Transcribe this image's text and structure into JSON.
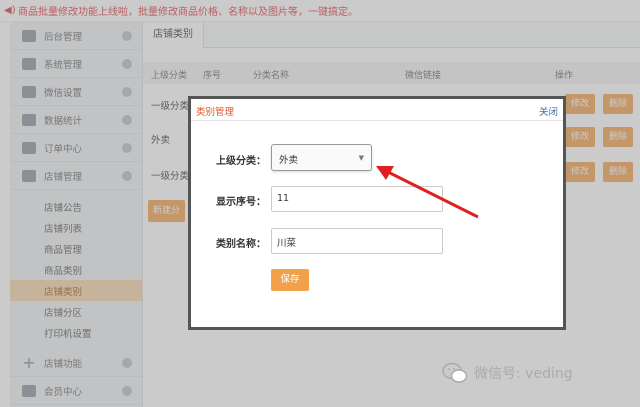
{
  "announcement": "商品批量修改功能上线啦，批量修改商品价格、名称以及图片等，一键搞定。",
  "sidebar": {
    "items": [
      {
        "label": "后台管理"
      },
      {
        "label": "系统管理"
      },
      {
        "label": "微信设置"
      },
      {
        "label": "数据统计"
      },
      {
        "label": "订单中心"
      },
      {
        "label": "店铺管理"
      }
    ],
    "subitems": [
      {
        "label": "店铺公告"
      },
      {
        "label": "店铺列表"
      },
      {
        "label": "商品管理"
      },
      {
        "label": "商品类别"
      },
      {
        "label": "店铺类别"
      },
      {
        "label": "店铺分区"
      },
      {
        "label": "打印机设置"
      }
    ],
    "bottom_items": [
      {
        "label": "店铺功能"
      },
      {
        "label": "会员中心"
      }
    ]
  },
  "main": {
    "tab": "店铺类别",
    "columns": [
      "上级分类",
      "序号",
      "分类名称",
      "微信链接",
      "操作"
    ],
    "rows": [
      {
        "label": "一级分类"
      },
      {
        "label": "外卖"
      },
      {
        "label": "一级分类"
      }
    ],
    "edit_label": "修改",
    "delete_label": "删除",
    "new_label": "新建分"
  },
  "modal": {
    "title": "类别管理",
    "close": "关闭",
    "parent_label": "上级分类：",
    "parent_value": "外卖",
    "order_label": "显示序号：",
    "order_value": "11",
    "name_label": "类别名称：",
    "name_value": "川菜",
    "save": "保存"
  },
  "watermark": "微信号: veding",
  "colors": {
    "accent": "#f3a04b",
    "alert_text": "#e0393e",
    "arrow": "#e02020",
    "active_bg": "#f5d3a8"
  }
}
